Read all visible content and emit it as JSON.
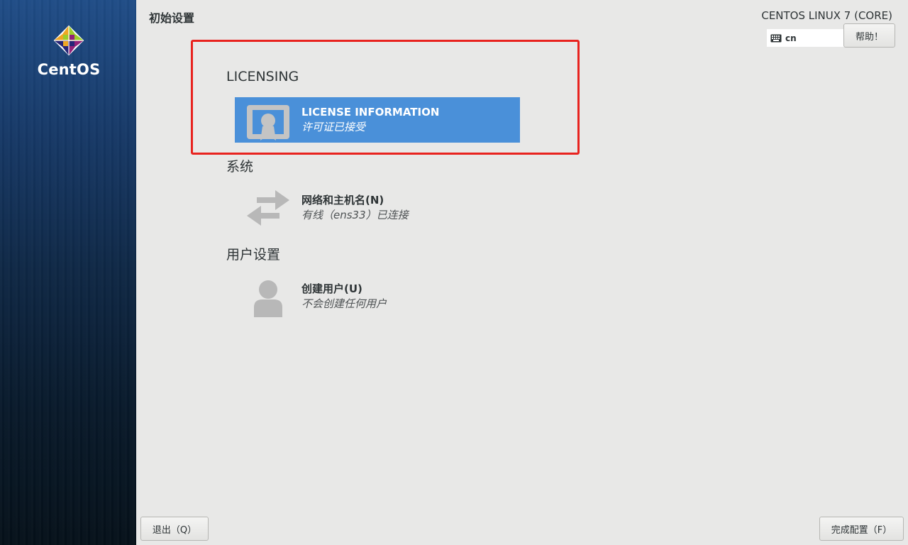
{
  "sidebar": {
    "logo_text": "CentOS"
  },
  "header": {
    "title": "初始设置",
    "product": "CENTOS LINUX 7 (CORE)",
    "keyboard_layout": "cn",
    "help_label": "帮助！"
  },
  "sections": {
    "licensing": {
      "title": "LICENSING",
      "spoke": {
        "title": "LICENSE INFORMATION",
        "status": "许可证已接受"
      }
    },
    "system": {
      "title": "系统",
      "spoke": {
        "title": "网络和主机名(N)",
        "status": "有线（ens33）已连接"
      }
    },
    "user": {
      "title": "用户设置",
      "spoke": {
        "title": "创建用户(U)",
        "status": "不会创建任何用户"
      }
    }
  },
  "footer": {
    "quit_label": "退出（Q）",
    "finish_label": "完成配置（F）"
  },
  "colors": {
    "selected_spoke": "#4a90d9",
    "highlight_border": "#e8231f",
    "background": "#e8e8e7"
  }
}
